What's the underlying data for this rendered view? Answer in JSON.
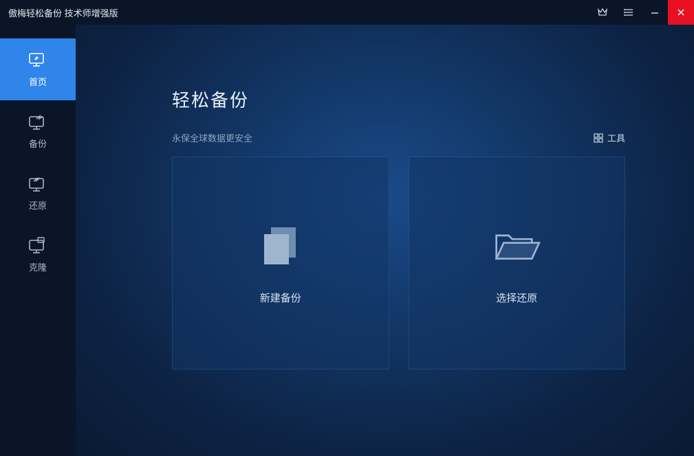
{
  "titlebar": {
    "title": "傲梅轻松备份 技术师增强版"
  },
  "sidebar": {
    "items": [
      {
        "label": "首页"
      },
      {
        "label": "备份"
      },
      {
        "label": "还原"
      },
      {
        "label": "克隆"
      }
    ]
  },
  "main": {
    "title": "轻松备份",
    "subtitle": "永保全球数据更安全",
    "tools_label": "工具"
  },
  "cards": {
    "new_backup": "新建备份",
    "choose_restore": "选择还原"
  }
}
